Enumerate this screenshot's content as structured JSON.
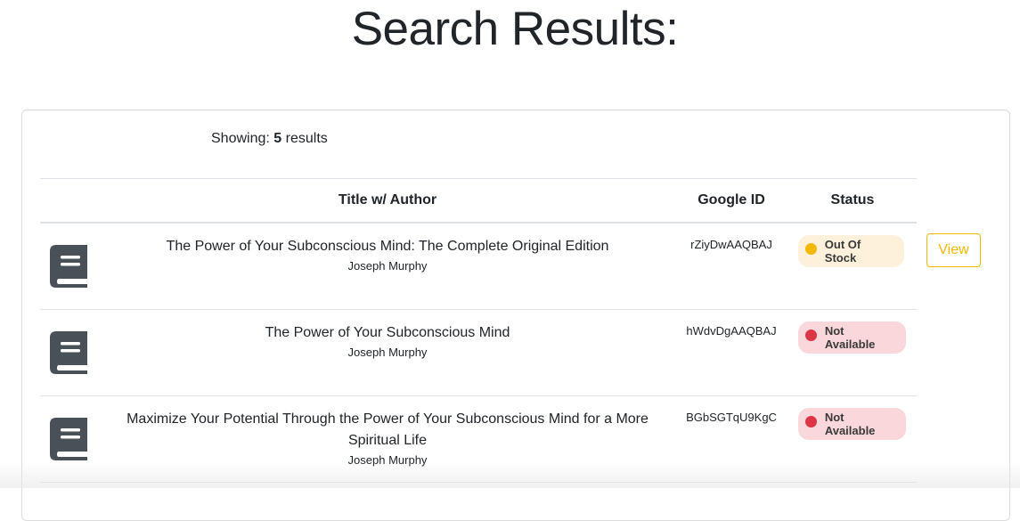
{
  "page": {
    "title": "Search Results:"
  },
  "summary": {
    "prefix": "Showing:",
    "count": "5",
    "suffix": "results"
  },
  "table": {
    "headers": {
      "title": "Title w/ Author",
      "google_id": "Google ID",
      "status": "Status"
    },
    "rows": [
      {
        "title": "The Power of Your Subconscious Mind: The Complete Original Edition",
        "author": "Joseph Murphy",
        "google_id": "rZiyDwAAQBAJ",
        "status": "Out Of Stock",
        "status_color": "#f5b800",
        "action": "View"
      },
      {
        "title": "The Power of Your Subconscious Mind",
        "author": "Joseph Murphy",
        "google_id": "hWdvDgAAQBAJ",
        "status": "Not Available",
        "status_color": "#dc3545"
      },
      {
        "title": "Maximize Your Potential Through the Power of Your Subconscious Mind for a More Spiritual Life",
        "author": "Joseph Murphy",
        "google_id": "BGbSGTqU9KgC",
        "status": "Not Available",
        "status_color": "#dc3545"
      }
    ]
  },
  "icons": {
    "book": "book-icon"
  },
  "colors": {
    "warning": "#f5b800",
    "danger": "#dc3545",
    "icon": "#495057"
  }
}
